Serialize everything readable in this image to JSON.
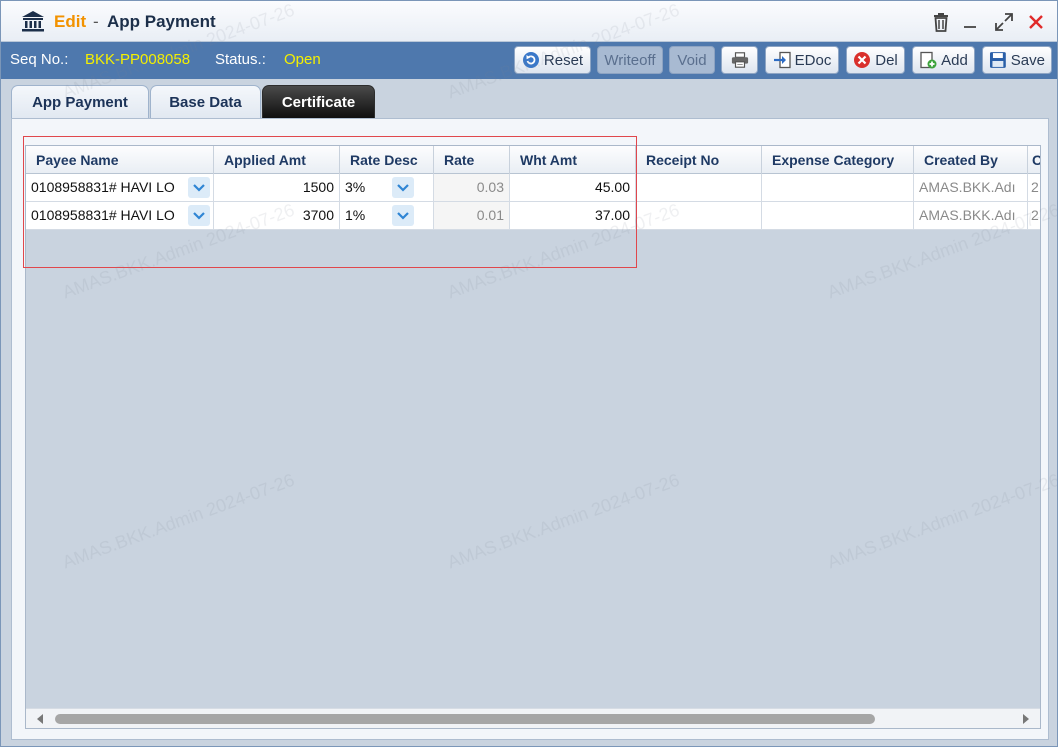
{
  "window": {
    "mode": "Edit",
    "separator": "-",
    "title": "App Payment"
  },
  "status_bar": {
    "seq_label": "Seq No.:",
    "seq_value": "BKK-PP008058",
    "status_label": "Status.:",
    "status_value": "Open",
    "buttons": {
      "reset": "Reset",
      "writeoff": "Writeoff",
      "void": "Void",
      "edoc": "EDoc",
      "del": "Del",
      "add": "Add",
      "save": "Save"
    }
  },
  "tabs": [
    {
      "label": "App Payment",
      "active": false
    },
    {
      "label": "Base Data",
      "active": false
    },
    {
      "label": "Certificate",
      "active": true
    }
  ],
  "grid": {
    "columns": [
      "Payee Name",
      "Applied Amt",
      "Rate Desc",
      "Rate",
      "Wht Amt",
      "Receipt No",
      "Expense Category",
      "Created By",
      "C"
    ],
    "rows": [
      {
        "payee_name": "0108958831# HAVI LO",
        "applied_amt": "1500",
        "rate_desc": "3%",
        "rate": "0.03",
        "wht_amt": "45.00",
        "receipt_no": "",
        "expense_category": "",
        "created_by": "AMAS.BKK.Adı",
        "extra": "2"
      },
      {
        "payee_name": "0108958831# HAVI LO",
        "applied_amt": "3700",
        "rate_desc": "1%",
        "rate": "0.01",
        "wht_amt": "37.00",
        "receipt_no": "",
        "expense_category": "",
        "created_by": "AMAS.BKK.Adı",
        "extra": "2"
      }
    ]
  },
  "watermark_text": "AMAS.BKK.Admin 2024-07-26",
  "colors": {
    "status_bar_bg": "#4e78ad",
    "status_value": "#f5f000",
    "title_mode": "#f29200",
    "highlight_border": "#e0474c"
  }
}
